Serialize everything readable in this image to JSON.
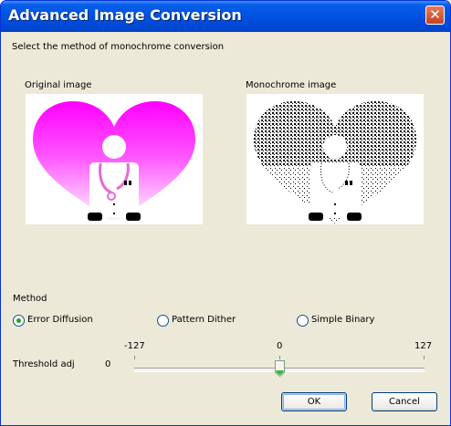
{
  "dialog": {
    "title": "Advanced Image Conversion",
    "instruction": "Select the method of monochrome conversion"
  },
  "preview": {
    "original_label": "Original image",
    "mono_label": "Monochrome image"
  },
  "method": {
    "label": "Method",
    "options": [
      {
        "label": "Error Diffusion",
        "selected": true
      },
      {
        "label": "Pattern Dither",
        "selected": false
      },
      {
        "label": "Simple Binary",
        "selected": false
      }
    ]
  },
  "threshold": {
    "label": "Threshold adj",
    "value": "0",
    "min_label": "-127",
    "mid_label": "0",
    "max_label": "127",
    "min": -127,
    "max": 127,
    "current": 0
  },
  "buttons": {
    "ok": "OK",
    "cancel": "Cancel"
  },
  "colors": {
    "title_bar": "#0054e3",
    "dialog_bg": "#ece9d8",
    "heart_top": "#ff00ff",
    "heart_bottom": "#ffffff",
    "radio_dot": "#21a121"
  }
}
